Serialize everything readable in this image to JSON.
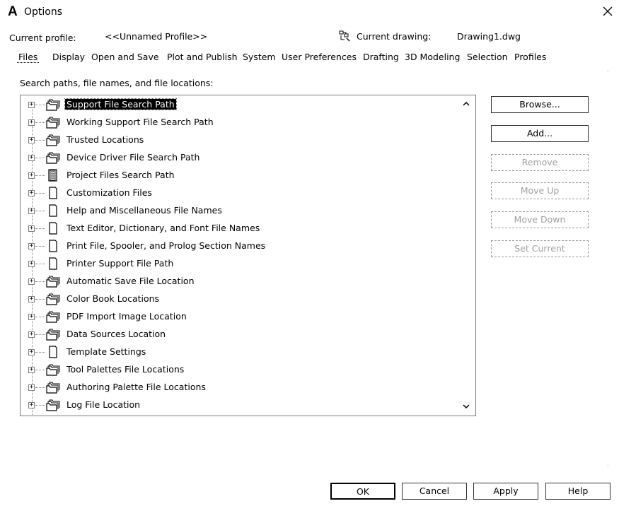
{
  "window": {
    "title": "Options",
    "app_icon_glyph": "A"
  },
  "header": {
    "profile_label": "Current profile:",
    "profile_value": "<<Unnamed Profile>>",
    "drawing_label": "Current drawing:",
    "drawing_value": "Drawing1.dwg"
  },
  "tabs": [
    {
      "label": "Files",
      "active": true
    },
    {
      "label": "Display"
    },
    {
      "label": "Open and Save"
    },
    {
      "label": "Plot and Publish"
    },
    {
      "label": "System"
    },
    {
      "label": "User Preferences"
    },
    {
      "label": "Drafting"
    },
    {
      "label": "3D Modeling"
    },
    {
      "label": "Selection"
    },
    {
      "label": "Profiles"
    }
  ],
  "files_panel": {
    "section_label": "Search paths, file names, and file locations:",
    "tree": [
      {
        "label": "Support File Search Path",
        "icon": "folders-icon",
        "selected": true
      },
      {
        "label": "Working Support File Search Path",
        "icon": "folders-icon"
      },
      {
        "label": "Trusted Locations",
        "icon": "folders-icon"
      },
      {
        "label": "Device Driver File Search Path",
        "icon": "folders-icon"
      },
      {
        "label": "Project Files Search Path",
        "icon": "project-icon"
      },
      {
        "label": "Customization Files",
        "icon": "document-icon"
      },
      {
        "label": "Help and Miscellaneous File Names",
        "icon": "document-icon"
      },
      {
        "label": "Text Editor, Dictionary, and Font File Names",
        "icon": "document-icon"
      },
      {
        "label": "Print File, Spooler, and Prolog Section Names",
        "icon": "document-icon"
      },
      {
        "label": "Printer Support File Path",
        "icon": "document-icon"
      },
      {
        "label": "Automatic Save File Location",
        "icon": "folders-icon"
      },
      {
        "label": "Color Book Locations",
        "icon": "folders-icon"
      },
      {
        "label": "PDF Import Image Location",
        "icon": "folders-icon"
      },
      {
        "label": "Data Sources Location",
        "icon": "folders-icon"
      },
      {
        "label": "Template Settings",
        "icon": "document-icon"
      },
      {
        "label": "Tool Palettes File Locations",
        "icon": "folders-icon"
      },
      {
        "label": "Authoring Palette File Locations",
        "icon": "folders-icon"
      },
      {
        "label": "Log File Location",
        "icon": "folders-icon"
      }
    ],
    "buttons": {
      "browse": "Browse...",
      "add": "Add...",
      "remove": "Remove",
      "move_up": "Move Up",
      "move_down": "Move Down",
      "set_current": "Set Current"
    }
  },
  "footer": {
    "ok": "OK",
    "cancel": "Cancel",
    "apply": "Apply",
    "help": "Help"
  }
}
